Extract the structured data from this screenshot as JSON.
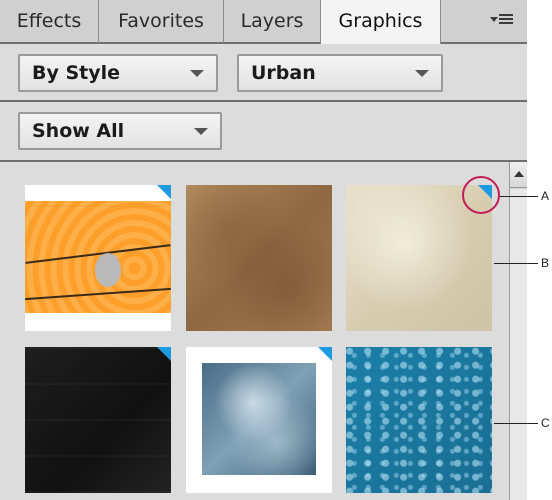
{
  "tabs": [
    {
      "label": "Effects"
    },
    {
      "label": "Favorites"
    },
    {
      "label": "Layers"
    },
    {
      "label": "Graphics",
      "active": true
    }
  ],
  "panel_menu_icon": "panel-options-menu-icon",
  "filters": {
    "category": {
      "selected": "By Style"
    },
    "style": {
      "selected": "Urban"
    },
    "display": {
      "selected": "Show All"
    }
  },
  "thumbnails": [
    {
      "description": "orange background with barbed wire",
      "downloadable": true
    },
    {
      "description": "brown grunge texture",
      "downloadable": false
    },
    {
      "description": "beige paper texture",
      "downloadable": true
    },
    {
      "description": "black texture",
      "downloadable": true
    },
    {
      "description": "blue cloud texture",
      "downloadable": true
    },
    {
      "description": "blue pattern texture",
      "downloadable": false
    }
  ],
  "callouts": {
    "a": "A",
    "b": "B",
    "c": "C"
  },
  "colors": {
    "download_indicator": "#1e9ae0",
    "highlight_ring": "#c31a5a",
    "panel_background": "#dcdcdc",
    "active_tab": "#f4f4f4"
  }
}
